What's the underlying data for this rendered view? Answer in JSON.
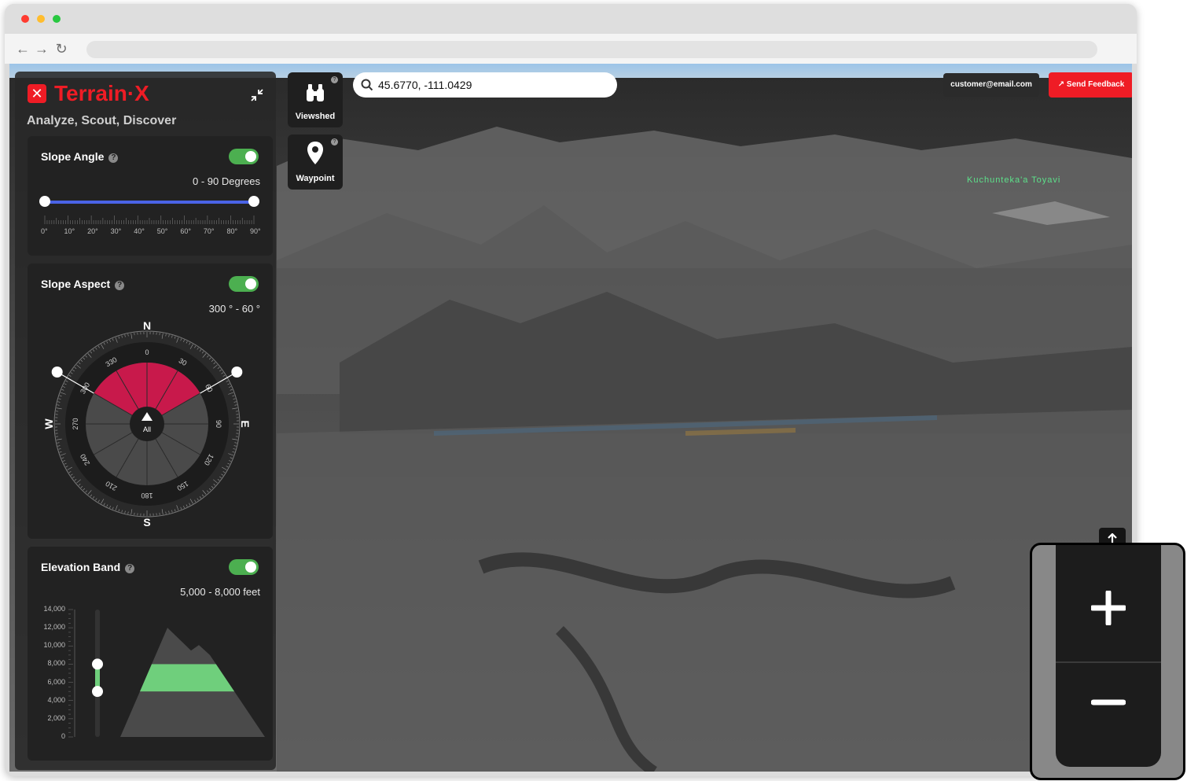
{
  "app": {
    "brand_name": "Terrain·X",
    "brand_mark": "✕",
    "tagline": "Analyze, Scout, Discover"
  },
  "search": {
    "value": "45.6770, -111.0429",
    "placeholder": ""
  },
  "account": {
    "email": "customer@email.com"
  },
  "feedback": {
    "label": "Send Feedback"
  },
  "tools": [
    {
      "label": "Viewshed",
      "icon": "binoculars-icon"
    },
    {
      "label": "Waypoint",
      "icon": "map-pin-icon"
    }
  ],
  "slope_angle": {
    "title": "Slope Angle",
    "range_text": "0 - 90 Degrees",
    "enabled": true,
    "min": 0,
    "max": 90,
    "selected": [
      0,
      90
    ],
    "tick_labels": [
      "0°",
      "10°",
      "20°",
      "30°",
      "40°",
      "50°",
      "60°",
      "70°",
      "80°",
      "90°"
    ]
  },
  "slope_aspect": {
    "title": "Slope Aspect",
    "range_text": "300 ° - 60 °",
    "enabled": true,
    "selected": [
      300,
      60
    ],
    "cardinals": {
      "n": "N",
      "e": "E",
      "s": "S",
      "w": "W"
    },
    "degree_labels": [
      "0",
      "30",
      "60",
      "90",
      "120",
      "150",
      "180",
      "210",
      "240",
      "270",
      "300",
      "330"
    ],
    "center_label": "All"
  },
  "elevation_band": {
    "title": "Elevation Band",
    "range_text": "5,000 - 8,000 feet",
    "enabled": true,
    "selected": [
      5000,
      8000
    ],
    "axis_labels": [
      "14,000",
      "12,000",
      "10,000",
      "8,000",
      "6,000",
      "4,000",
      "2,000",
      "0"
    ]
  },
  "map": {
    "place_label": "Kuchunteka'a Toyavi"
  },
  "colors": {
    "brand": "#ef1c25",
    "toggle_on": "#4caf50",
    "slider": "#4a63e6",
    "aspect_fill": "#c8194b",
    "band_fill": "#6fcf7c"
  }
}
